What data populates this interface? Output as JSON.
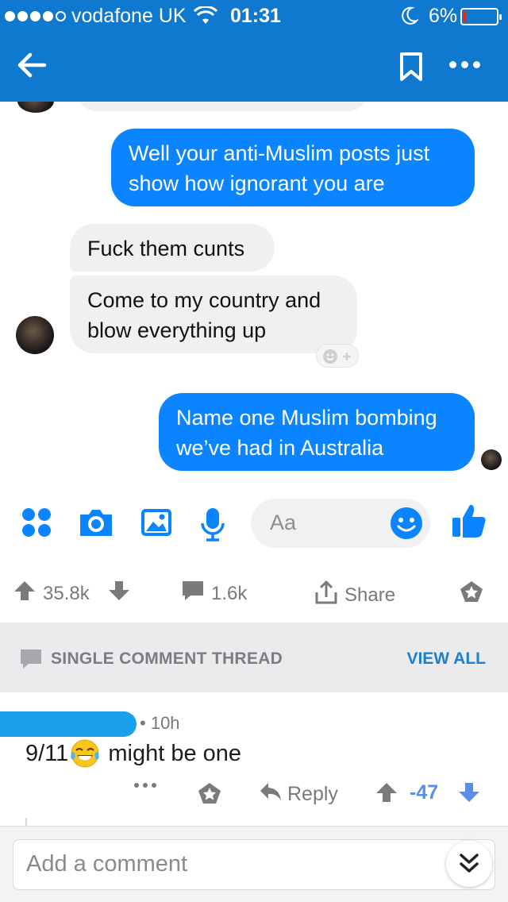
{
  "status_bar": {
    "carrier": "vodafone UK",
    "time": "01:31",
    "battery_percent": "6%",
    "battery_level": 0.06,
    "signal_bars_filled": 4,
    "signal_bars_total": 5
  },
  "app_bar": {
    "icons": [
      "back-arrow-icon",
      "bookmark-icon",
      "more-icon"
    ],
    "color": "#0f79d0"
  },
  "messenger": {
    "messages": [
      {
        "from": "me",
        "text": "Well your anti-Muslim posts just show how ignorant you are"
      },
      {
        "from": "them",
        "text": "Fuck them cunts"
      },
      {
        "from": "them",
        "text": "Come to my country and blow everything up"
      },
      {
        "from": "me",
        "text": "Name one Muslim bombing we’ve had in Australia"
      }
    ],
    "input_placeholder": "Aa",
    "accent": "#0a84ff"
  },
  "post_actions": {
    "upvotes": "35.8k",
    "comments": "1.6k",
    "share_label": "Share"
  },
  "thread": {
    "label": "SINGLE COMMENT THREAD",
    "view_all": "VIEW ALL"
  },
  "comment": {
    "time": "10h",
    "text_before": "9/11",
    "text_after": " might be one",
    "emoji": "tears-of-joy",
    "reply_label": "Reply",
    "score": "-47",
    "score_color": "#5a8ee8"
  },
  "footer": {
    "placeholder": "Add a comment"
  }
}
